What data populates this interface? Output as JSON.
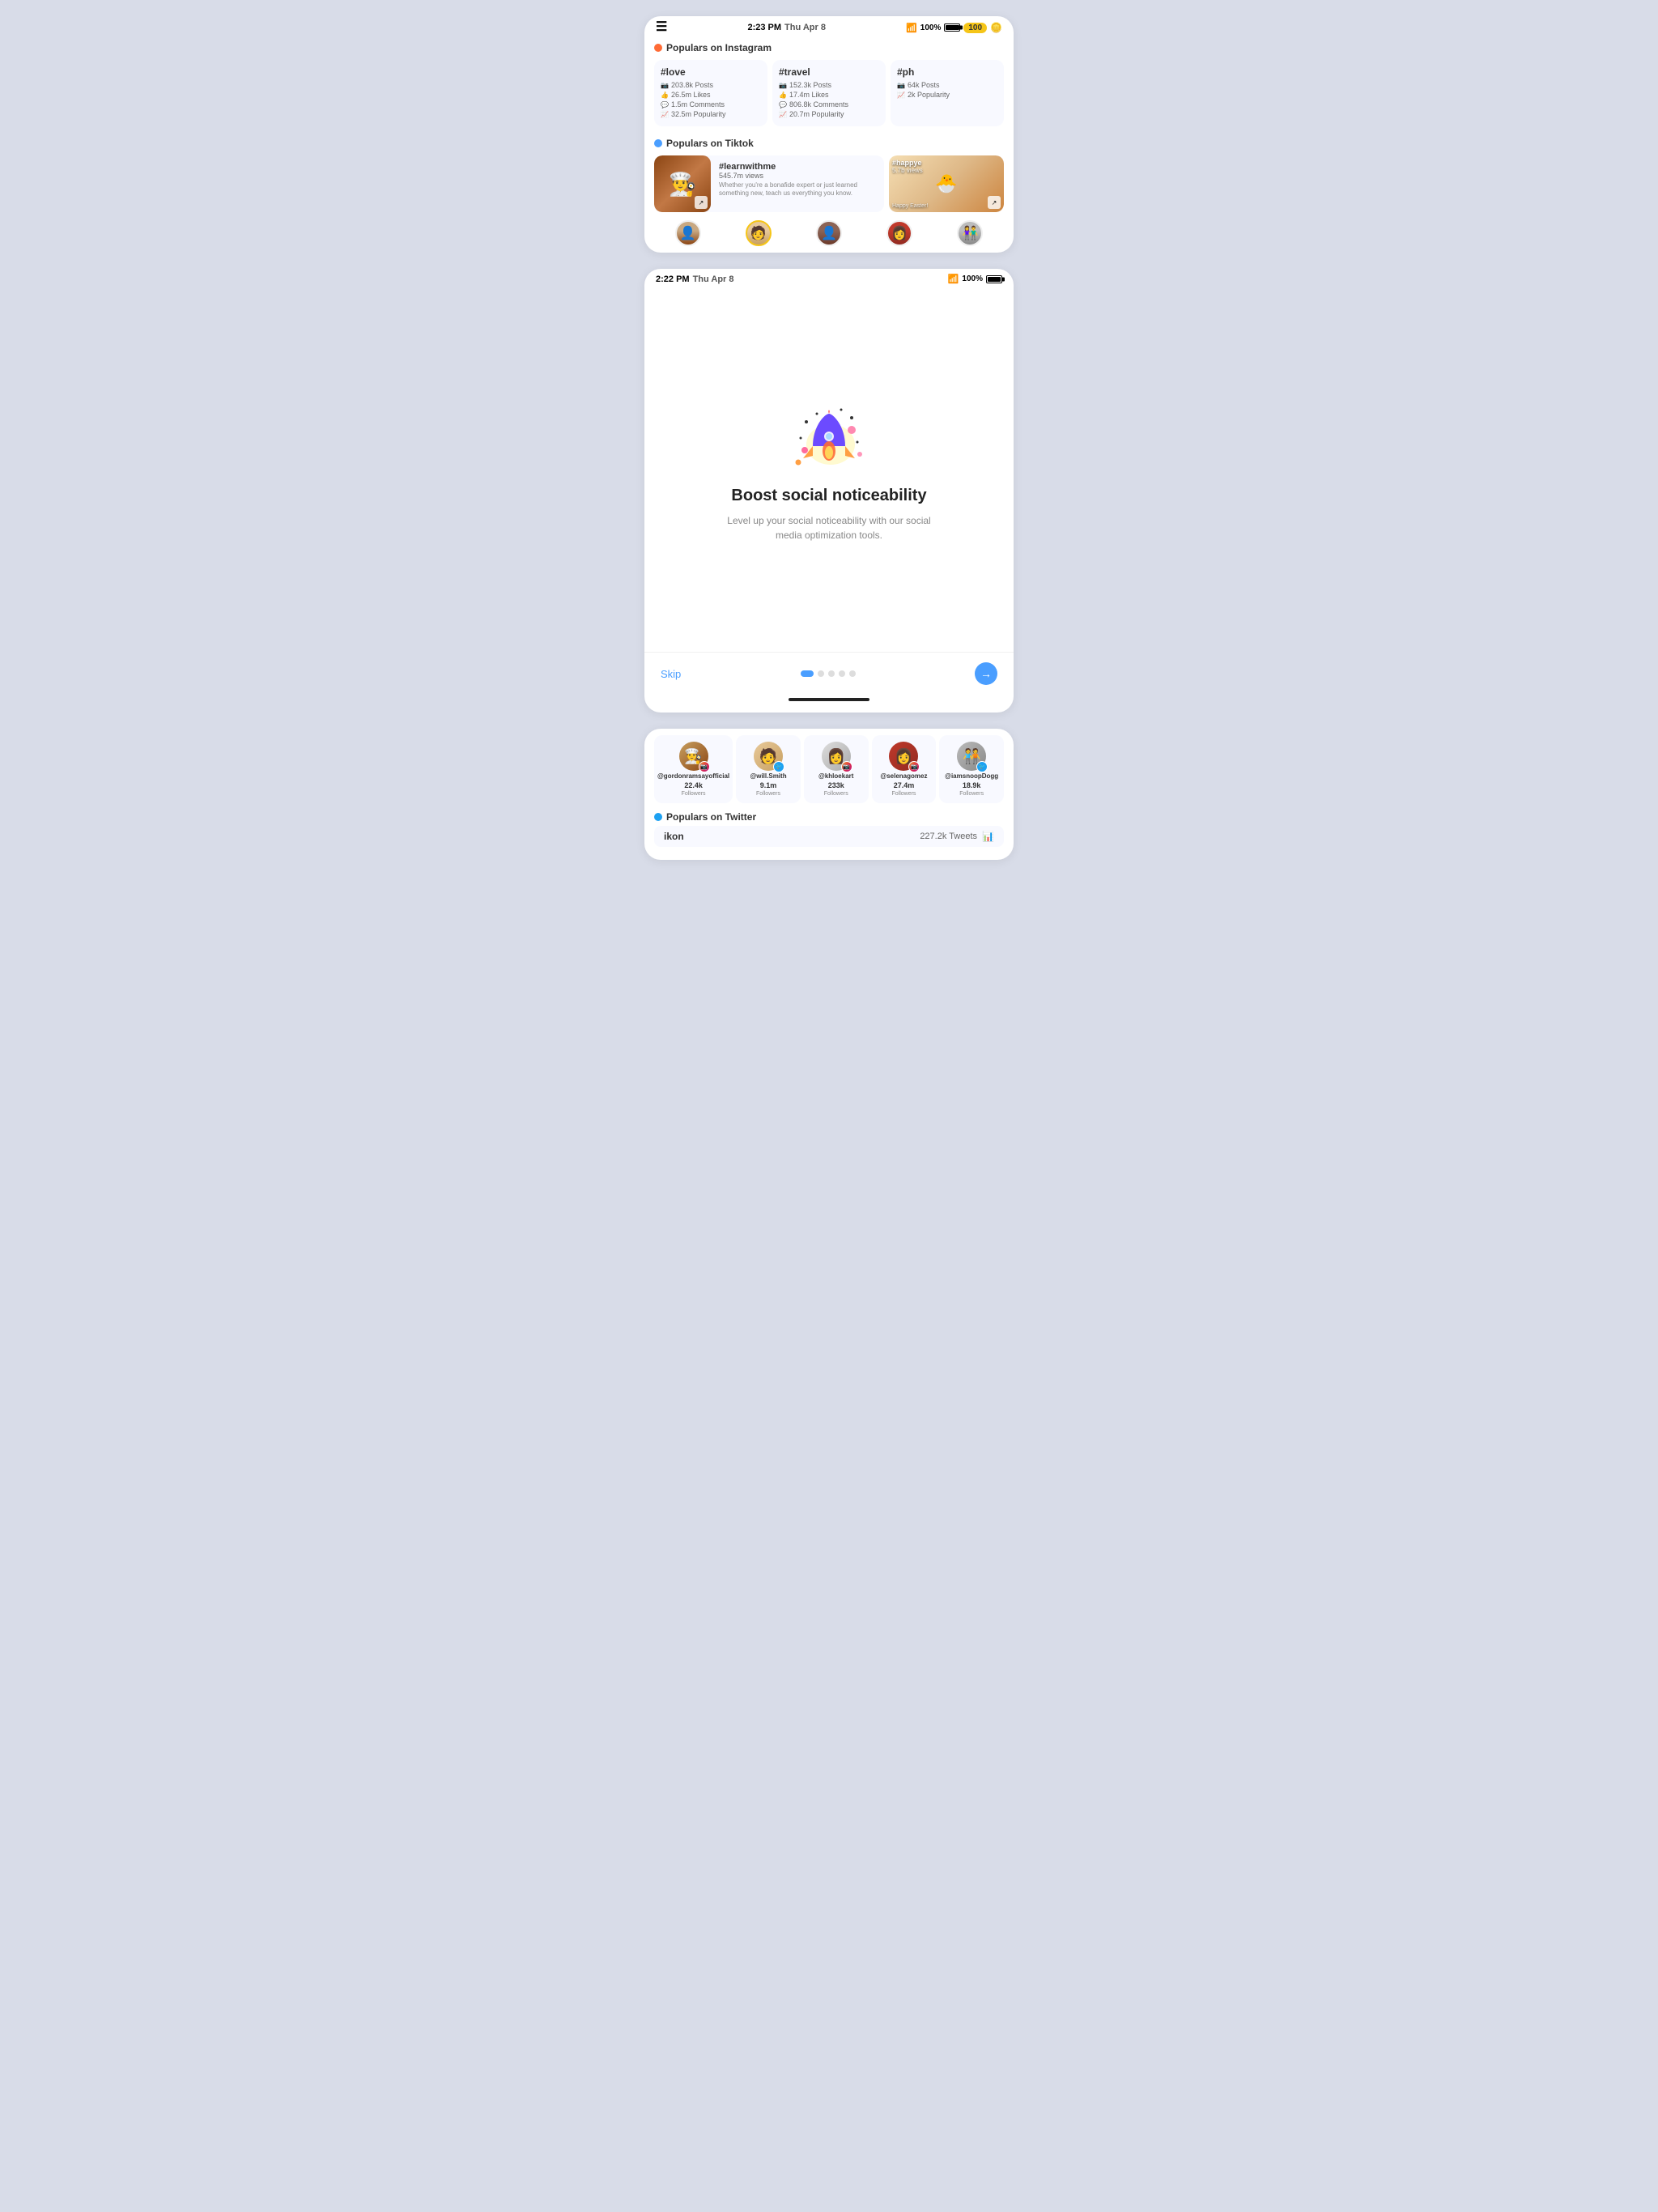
{
  "screen1": {
    "status": {
      "time": "2:23 PM",
      "day": "Thu Apr 8",
      "battery": "100%",
      "coins": "100"
    },
    "instagram_section": {
      "label": "Populars on Instagram",
      "hashtags": [
        {
          "tag": "#love",
          "posts": "203.8k Posts",
          "likes": "26.5m Likes",
          "comments": "1.5m Comments",
          "popularity": "32.5m Popularity"
        },
        {
          "tag": "#travel",
          "posts": "152.3k Posts",
          "likes": "17.4m Likes",
          "comments": "806.8k Comments",
          "popularity": "20.7m Popularity"
        },
        {
          "tag": "#ph",
          "posts": "64k Posts",
          "likes": "",
          "comments": "",
          "popularity": "2k Popularity"
        }
      ]
    },
    "tiktok_section": {
      "label": "Populars on Tiktok",
      "items": [
        {
          "tag": "#learnwithme",
          "views": "545.7m views",
          "desc": "Whether you're a bonafide expert or just learned something new, teach us everything you know."
        },
        {
          "tag": "#happye",
          "views": "5.7b views",
          "desc": "Happy Easter!"
        }
      ]
    },
    "avatars": [
      {
        "initial": "👤",
        "type": "av1"
      },
      {
        "initial": "👤",
        "type": "av2",
        "active": true
      },
      {
        "initial": "👤",
        "type": "av3"
      },
      {
        "initial": "👤",
        "type": "av4"
      },
      {
        "initial": "👤",
        "type": "av5"
      }
    ]
  },
  "screen2": {
    "status": {
      "time": "2:22 PM",
      "day": "Thu Apr 8",
      "battery": "100%"
    },
    "onboarding": {
      "title": "Boost social noticeability",
      "description": "Level up your social noticeability with our social media optimization tools.",
      "skip_label": "Skip",
      "next_arrow": "→",
      "dots": [
        {
          "active": true
        },
        {
          "active": false
        },
        {
          "active": false
        },
        {
          "active": false
        },
        {
          "active": false
        }
      ]
    }
  },
  "screen3": {
    "users": [
      {
        "handle": "@gordonramsayofficial",
        "count": "22.4k",
        "label": "Followers"
      },
      {
        "handle": "@will.Smith",
        "count": "9.1m",
        "label": "Followers"
      },
      {
        "handle": "@khloekart",
        "count": "233k",
        "label": "Followers"
      },
      {
        "handle": "@selenagomez",
        "count": "27.4m",
        "label": "Followers"
      },
      {
        "handle": "@iamsnoopDogg",
        "count": "18.9k",
        "label": "Followers"
      }
    ],
    "twitter_section": {
      "label": "Populars on Twitter",
      "item": {
        "handle": "ikon",
        "tweets": "227.2k Tweets"
      }
    }
  }
}
